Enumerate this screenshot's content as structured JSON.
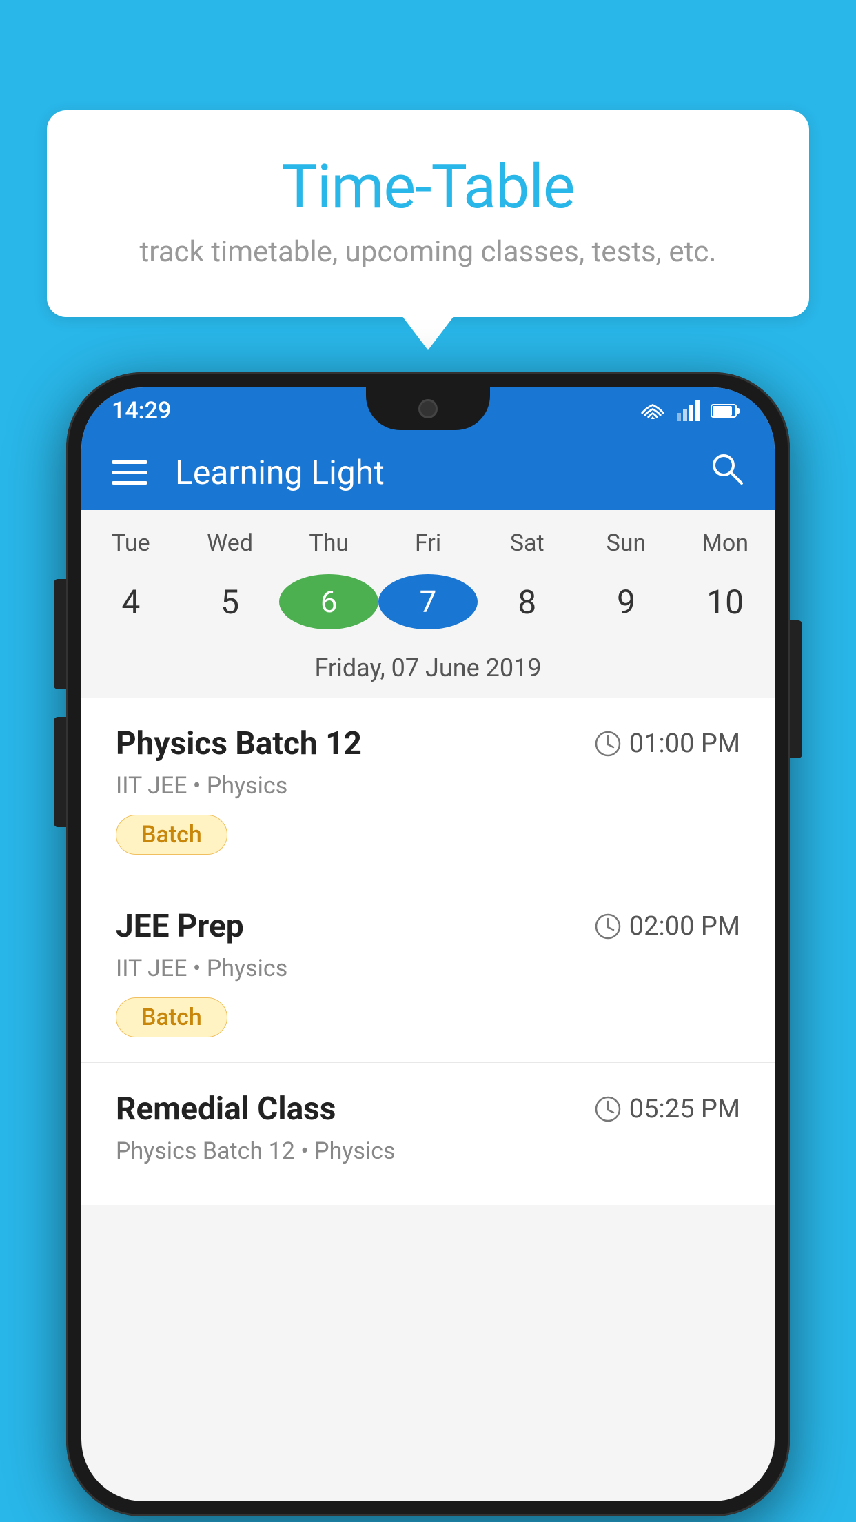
{
  "background": {
    "color": "#29B6E8"
  },
  "bubble": {
    "title": "Time-Table",
    "subtitle": "track timetable, upcoming classes, tests, etc."
  },
  "app": {
    "title": "Learning Light"
  },
  "status_bar": {
    "time": "14:29"
  },
  "calendar": {
    "days": [
      "Tue",
      "Wed",
      "Thu",
      "Fri",
      "Sat",
      "Sun",
      "Mon"
    ],
    "dates": [
      "4",
      "5",
      "6",
      "7",
      "8",
      "9",
      "10"
    ],
    "today_index": 2,
    "selected_index": 3,
    "selected_label": "Friday, 07 June 2019"
  },
  "classes": [
    {
      "name": "Physics Batch 12",
      "time": "01:00 PM",
      "meta": "IIT JEE • Physics",
      "badge": "Batch"
    },
    {
      "name": "JEE Prep",
      "time": "02:00 PM",
      "meta": "IIT JEE • Physics",
      "badge": "Batch"
    },
    {
      "name": "Remedial Class",
      "time": "05:25 PM",
      "meta": "Physics Batch 12 • Physics",
      "badge": ""
    }
  ]
}
